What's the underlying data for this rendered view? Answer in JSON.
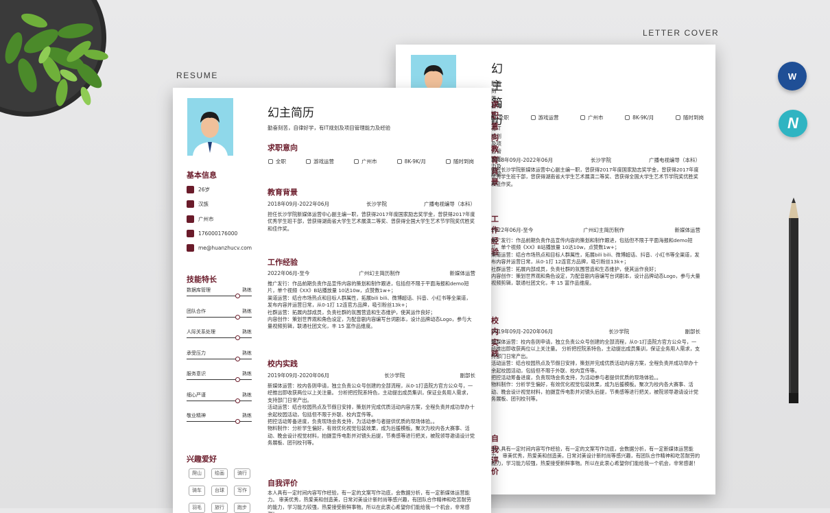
{
  "labels": {
    "resume": "RESUME",
    "letter_cover": "LETTER COVER"
  },
  "icons": {
    "word": "word-app-icon",
    "n": "app-icon"
  },
  "resume": {
    "name": "幻主简历",
    "subtitle": "勤奋刻苦，自律好学，有IT规划及项目管理能力及经验",
    "sections": {
      "intent": "求职意向",
      "education": "教育背景",
      "work": "工作经验",
      "campus": "校内实践",
      "self": "自我评价"
    },
    "intent": [
      "全职",
      "游戏运营",
      "广州市",
      "8K-9K/月",
      "随时到岗"
    ],
    "education": {
      "date": "2018年09月-2022年06月",
      "school": "长沙学院",
      "major": "广播电视编导（本科）",
      "desc": "担任长沙学院新媒体运营中心副主编一职，曾获得2017年度国家励志奖学金，曾获得2017年度优秀学生班干部，曾获得湖南省大学生艺术展演二等奖、曾获得全国大学生艺术节学院奖优胜奖和佳作奖。"
    },
    "work": {
      "date": "2022年06月-至今",
      "company": "广州幻主简历制作",
      "role": "新媒体运营",
      "lines": [
        "推广发行：作品前期负责作品宣传内容的策划和制作跟进，包括但不限于平面海报和demo短片，单个视频《XX》B站播放量 10达10w，点赞数1w+；",
        "渠道运营：结合市场热点和目标人群属性，拓展bili bili、微博超话、抖音、小红书等全渠道，发布内容并运营日常，从0-1打 12连官方品牌，吸引粉丝13k+；",
        "社群运营：拓展内部成员，负责社群的氛围营造和生态维护，使其运作良好；",
        "内容创作：策划世界观和角色设定，为配音剧内容编写台词剧本，设计品牌动态Logo，参与大量视频剪辑，联通社团文化，丰 15 富作品维度。"
      ]
    },
    "campus": {
      "date": "2019年09月-2020年06月",
      "school": "长沙学院",
      "role": "副部长",
      "lines": [
        "新媒体运营：校内各则申请，独立负责公众号创建的全部流程，从0-1打造院方官方公众号，一经推出即收获两位以上关注量。 分析把控院系特色，主动提出成员集训，保证业务用人需求，支持部门日常产出。",
        "活动运营：结合校园热点及节假日安排，策划并完成优质活动内容方案，全程负责并成功举办十余起校园活动，包括但不限于外联、校内宣传等。",
        "把控活动筹备进度，负责现场会务支持，为活动参与者提供优质的现场体验。。",
        "物料制作：分析学生偏好，有效优化视觉包装效果，成为后援模板。聚次为校内各大赛事、活动、晚会设计视觉材料，拍摄宣传电影并对镜头后提，节奏感等进行把关，被院领导邀请设计党务展板、团刊校刊等。"
      ]
    },
    "self": {
      "lines": [
        "本人具有一定时间内容写作经验，有一定的文案写作功底，会数据分析，有一定新媒体运营能力。 审美优秀，热爱美和创造美，日常对美设计新时尚等感兴趣，有团队合作精神和吃苦耐劳的能力，学习能力较强，热爱接受新鲜事物。所以在此衷心希望你们能给我一个机会，非常感谢！"
      ]
    },
    "sidebar": {
      "basic_title": "基本信息",
      "basic": [
        "26岁",
        "汉族",
        "广州市",
        "176000176000",
        "me@huanzhucv.com"
      ],
      "skills_title": "技能特长",
      "skills": [
        {
          "name": "数据库管理",
          "level": "熟练",
          "pct": 0.78
        },
        {
          "name": "团队合作",
          "level": "熟练",
          "pct": 0.78
        },
        {
          "name": "人际关系处理",
          "level": "熟练",
          "pct": 0.78
        },
        {
          "name": "承受压力",
          "level": "熟练",
          "pct": 0.78
        },
        {
          "name": "服务意识",
          "level": "熟练",
          "pct": 0.78
        },
        {
          "name": "细心严谨",
          "level": "熟练",
          "pct": 0.78
        },
        {
          "name": "敬业精神",
          "level": "熟练",
          "pct": 0.78
        }
      ],
      "hobby_title": "兴趣爱好",
      "hobbies": [
        "爬山",
        "绘画",
        "骑行",
        "骑车",
        "台球",
        "写作",
        "羽毛",
        "旅行",
        "跑步"
      ]
    }
  }
}
